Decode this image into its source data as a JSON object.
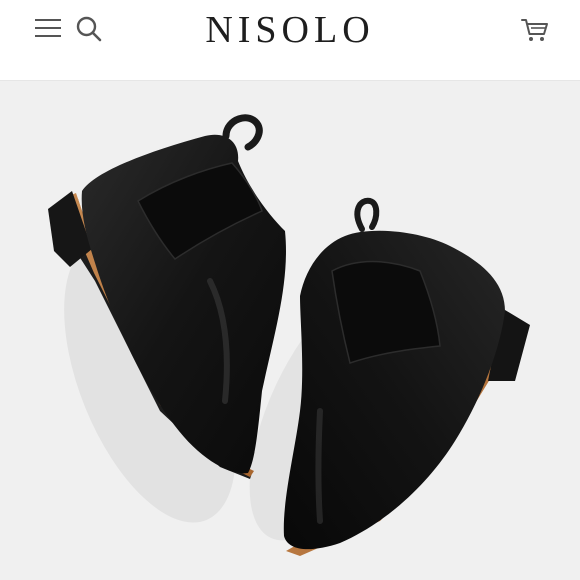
{
  "header": {
    "brand": "NISOLO",
    "menu_icon": "hamburger-menu-icon",
    "search_icon": "search-icon",
    "cart_icon": "shopping-cart-icon"
  },
  "hero": {
    "image": "black-leather-chelsea-boots-pair",
    "colors": {
      "background": "#f0f0f0",
      "leather": "#121212",
      "sole_welt": "#b8773f"
    }
  }
}
